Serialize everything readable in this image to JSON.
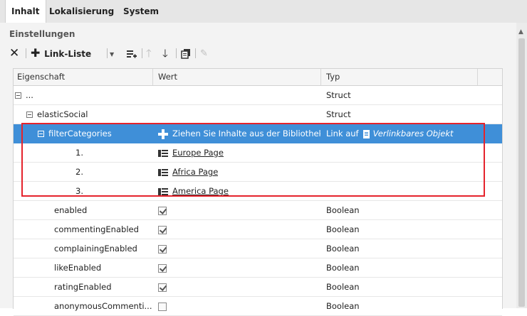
{
  "tabs": [
    "Inhalt",
    "Lokalisierung",
    "System"
  ],
  "section_title": "Einstellungen",
  "toolbar": {
    "link_list_label": "Link-Liste"
  },
  "columns": [
    "Eigenschaft",
    "Wert",
    "Typ"
  ],
  "rows": [
    {
      "name": "...",
      "value": "",
      "type": "Struct"
    },
    {
      "name": "elasticSocial",
      "value": "",
      "type": "Struct"
    },
    {
      "name": "filterCategories",
      "value": "Ziehen Sie Inhalte aus der Bibliothek",
      "type_prefix": "Link auf",
      "type": "Verlinkbares Objekt"
    },
    {
      "name": "1.",
      "value": "Europe Page",
      "type": ""
    },
    {
      "name": "2.",
      "value": "Africa Page",
      "type": ""
    },
    {
      "name": "3.",
      "value": "America Page",
      "type": ""
    },
    {
      "name": "enabled",
      "checked": true,
      "type": "Boolean"
    },
    {
      "name": "commentingEnabled",
      "checked": true,
      "type": "Boolean"
    },
    {
      "name": "complainingEnabled",
      "checked": true,
      "type": "Boolean"
    },
    {
      "name": "likeEnabled",
      "checked": true,
      "type": "Boolean"
    },
    {
      "name": "ratingEnabled",
      "checked": true,
      "type": "Boolean"
    },
    {
      "name": "anonymousCommenti...",
      "checked": false,
      "type": "Boolean"
    }
  ],
  "colors": {
    "selection": "#3f8fd8",
    "highlight_border": "#e5232c"
  },
  "icons": [
    "delete-icon",
    "add-icon",
    "dropdown-icon",
    "add-below-icon",
    "move-up-icon",
    "move-down-icon",
    "copy-icon",
    "edit-icon",
    "list-icon",
    "document-icon",
    "scroll-up-icon"
  ]
}
